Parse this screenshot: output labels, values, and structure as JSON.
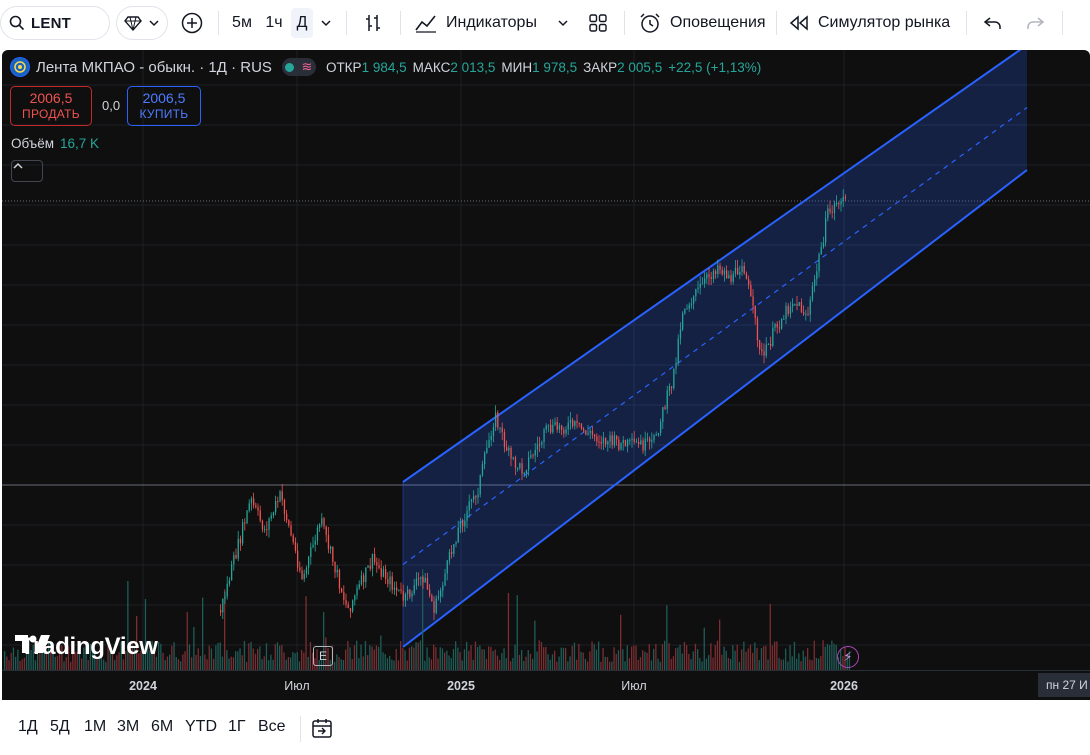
{
  "toolbar": {
    "symbol": "LENT",
    "intervals": [
      "5м",
      "1ч",
      "Д"
    ],
    "indicators_label": "Индикаторы",
    "alerts_label": "Оповещения",
    "replay_label": "Симулятор рынка"
  },
  "legend": {
    "title": "Лента МКПАО - обыкн. · 1Д · RUS",
    "open_label": "ОТКР",
    "open": "1 984,5",
    "high_label": "МАКС",
    "high": "2 013,5",
    "low_label": "МИН",
    "low": "1 978,5",
    "close_label": "ЗАКР",
    "close": "2 005,5",
    "change": "+22,5 (+1,13%)"
  },
  "trade": {
    "sell_price": "2006,5",
    "sell_label": "ПРОДАТЬ",
    "spread": "0,0",
    "buy_price": "2006,5",
    "buy_label": "КУПИТЬ"
  },
  "volume": {
    "label": "Объём",
    "value": "16,7 K"
  },
  "watermark": "TradingView",
  "earnings_badge": "E",
  "time_axis": {
    "labels": [
      "2024",
      "Июл",
      "2025",
      "Июл",
      "2026"
    ],
    "crosshair_date": "пн 27 И"
  },
  "bottom": {
    "ranges": [
      "1Д",
      "5Д",
      "1М",
      "3М",
      "6М",
      "YTD",
      "1Г",
      "Все"
    ]
  },
  "colors": {
    "up": "#26a69a",
    "down": "#ef5350",
    "channel": "#2962ff",
    "background": "#0f0f0f"
  }
}
